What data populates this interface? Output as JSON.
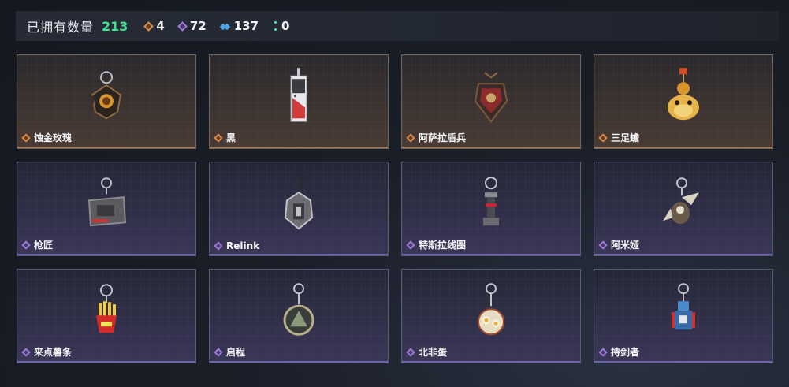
{
  "header": {
    "owned_label": "已拥有数量",
    "owned_count": "213",
    "stats": [
      {
        "icon": "orange-diamond-icon",
        "value": "4"
      },
      {
        "icon": "purple-diamond-icon",
        "value": "72"
      },
      {
        "icon": "blue-chevron-icon",
        "value": "137"
      },
      {
        "icon": "teal-dots-icon",
        "value": "0"
      }
    ]
  },
  "colors": {
    "owned_count": "#3be28f",
    "tier_orange": "#d98a4a",
    "tier_purple": "#9c7ad9",
    "tier_blue": "#4ea4e6",
    "tier_teal": "#3fd7c5"
  },
  "items": [
    {
      "name": "蚀金玫瑰",
      "tier": "orange",
      "icon": "rose-pendant-charm-icon"
    },
    {
      "name": "黑",
      "tier": "orange",
      "icon": "card-tag-charm-icon"
    },
    {
      "name": "阿萨拉盾兵",
      "tier": "orange",
      "icon": "shield-soldier-charm-icon"
    },
    {
      "name": "三足蟾",
      "tier": "orange",
      "icon": "three-legged-toad-charm-icon"
    },
    {
      "name": "枪匠",
      "tier": "purple",
      "icon": "gunsmith-box-charm-icon"
    },
    {
      "name": "Relink",
      "tier": "purple",
      "icon": "relink-shell-charm-icon"
    },
    {
      "name": "特斯拉线圈",
      "tier": "purple",
      "icon": "tesla-coil-charm-icon"
    },
    {
      "name": "阿米娅",
      "tier": "purple",
      "icon": "amiya-rabbit-charm-icon"
    },
    {
      "name": "来点薯条",
      "tier": "purple",
      "icon": "fries-charm-icon"
    },
    {
      "name": "启程",
      "tier": "purple",
      "icon": "departure-medal-charm-icon"
    },
    {
      "name": "北非蛋",
      "tier": "purple",
      "icon": "shakshuka-plate-charm-icon"
    },
    {
      "name": "持剑者",
      "tier": "purple",
      "icon": "swordbearer-figure-charm-icon"
    }
  ]
}
